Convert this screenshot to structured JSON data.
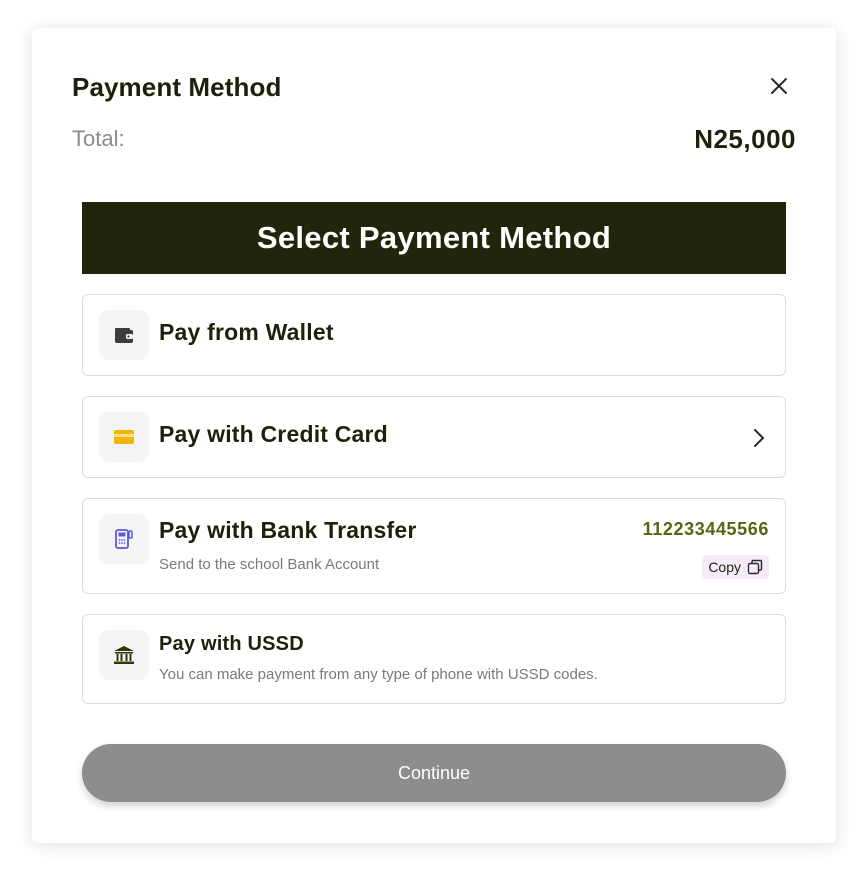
{
  "modal": {
    "title": "Payment Method",
    "close_icon": "close-icon",
    "total_label": "Total:",
    "total_value": "N25,000"
  },
  "banner": {
    "label": "Select Payment Method",
    "background": "#1f260b"
  },
  "options": [
    {
      "id": "wallet",
      "title": "Pay from Wallet",
      "icon": "wallet-icon",
      "icon_color": "#3c3c3c"
    },
    {
      "id": "card",
      "title": "Pay with Credit Card",
      "icon": "credit-card-icon",
      "icon_color": "#f5b400",
      "trailing_icon": "chevron-right-icon"
    },
    {
      "id": "bank",
      "title": "Pay with Bank Transfer",
      "subtitle": "Send to the school Bank Account",
      "icon": "pos-terminal-icon",
      "icon_color": "#5a5bd6",
      "account_number": "112233445566",
      "copy_label": "Copy",
      "copy_icon": "copy-icon"
    },
    {
      "id": "ussd",
      "title": "Pay with USSD",
      "subtitle": "You can make payment from any type of phone with USSD codes.",
      "icon": "bank-building-icon",
      "icon_color": "#2d3a0c"
    }
  ],
  "continue_label": "Continue",
  "colors": {
    "accent": "#4f6a12",
    "text": "#1c2209",
    "button_disabled": "#8d8d8d",
    "copy_bg": "#f6ebfa"
  }
}
